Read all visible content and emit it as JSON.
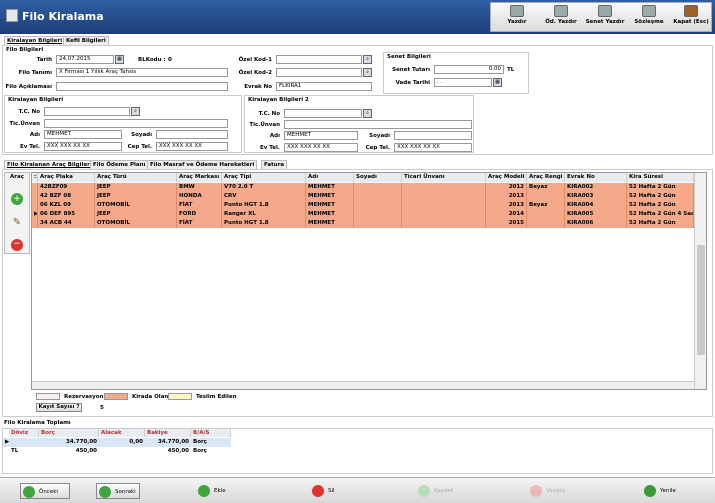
{
  "app": {
    "title": "Filo Kiralama"
  },
  "toolbar": [
    {
      "label": "Yazdır"
    },
    {
      "label": "Öd. Yazdır"
    },
    {
      "label": "Senet Yazdır"
    },
    {
      "label": "Sözleşme"
    },
    {
      "label": "Kapat (Esc)"
    }
  ],
  "tabs": {
    "top": [
      "Kiralayan Bilgileri",
      "Kefil Bilgileri"
    ],
    "grid": [
      "Filo Kiralanan Araç Bilgileri",
      "Filo Ödeme Planı",
      "Filo Masraf ve Ödeme Hareketleri",
      "Fatura"
    ]
  },
  "filo": {
    "section": "Filo Bilgileri",
    "tarih_label": "Tarih",
    "tarih": "24.07.2015",
    "blkodu_label": "BLKodu :",
    "blkodu": "0",
    "tanim_label": "Filo Tanımı",
    "tanim": "X Firması 1 Yıllık Araç Tahsis",
    "aciklama_label": "Filo Açıklaması",
    "aciklama": "",
    "ozel1_label": "Özel Kod-1",
    "ozel2_label": "Özel Kod-2",
    "evrak_label": "Evrak No",
    "evrak": "FLKIRA1"
  },
  "senet": {
    "section": "Senet Bilgileri",
    "tutar_label": "Senet Tutarı",
    "tutar": "0,00",
    "unit": "TL",
    "vade_label": "Vade Tarihi",
    "vade": ". ."
  },
  "kiralayan": {
    "section": "Kiralayan Bilgileri",
    "tc_label": "T.C. No",
    "unvan_label": "Tic.Ünvan",
    "adi_label": "Adı",
    "adi": "MEHMET",
    "soyadi_label": "Soyadı",
    "evtel_label": "Ev Tel.",
    "evtel": "XXX XXX XX XX",
    "ceptel_label": "Cep Tel.",
    "ceptel": "XXX XXX XX XX"
  },
  "kiralayan2": {
    "section": "Kiralayan Bilgileri 2",
    "tc_label": "T.C. No",
    "unvan_label": "Tic.Ünvan",
    "adi_label": "Adı",
    "adi": "MEHMET",
    "soyadi_label": "Soyadı",
    "evtel_label": "Ev Tel.",
    "evtel": "XXX XXX XX XX",
    "ceptel_label": "Cep Tel.",
    "ceptel": "XXX XXX XX XX"
  },
  "side": {
    "label": "Araç"
  },
  "grid": {
    "columns": [
      "Araç Plaka",
      "Araç Türü",
      "Araç Markası",
      "Araç Tipi",
      "Adı",
      "Soyadı",
      "Ticari Ünvanı",
      "Araç Modeli",
      "Araç Rengi",
      "Evrak No",
      "Kira Süresi"
    ],
    "rows": [
      [
        "42BZF09",
        "JEEP",
        "BMW",
        "V70 2.0 T",
        "MEHMET",
        "",
        "",
        "2012",
        "Beyaz",
        "KIRA002",
        "52 Hafta 2 Gün"
      ],
      [
        "42 BZF 08",
        "JEEP",
        "HONDA",
        "CRV",
        "MEHMET",
        "",
        "",
        "2013",
        "",
        "KIRA003",
        "52 Hafta 2 Gün"
      ],
      [
        "06 KZL 09",
        "OTOMOBİL",
        "FİAT",
        "Punto HGT 1.8",
        "MEHMET",
        "",
        "",
        "2013",
        "Beyaz",
        "KIRA004",
        "52 Hafta 2 Gün"
      ],
      [
        "06 DEF 895",
        "JEEP",
        "FORD",
        "Ranger XL",
        "MEHMET",
        "",
        "",
        "2014",
        "",
        "KIRA005",
        "52 Hafta 2 Gün 4 Saat"
      ],
      [
        "34 ACB 44",
        "OTOMOBİL",
        "FİAT",
        "Punto HGT 1.8",
        "MEHMET",
        "",
        "",
        "2015",
        "",
        "KIRA006",
        "52 Hafta 2 Gün"
      ]
    ]
  },
  "legend": {
    "items": [
      {
        "label": "Rezervasyon",
        "color": "#f8eef2"
      },
      {
        "label": "Kirada Olan",
        "color": "#f4a98a"
      },
      {
        "label": "Teslim Edilen",
        "color": "#fbf6c6"
      }
    ],
    "count_label": "Kayıt Sayısı ?",
    "count": "5"
  },
  "totals": {
    "section": "Filo Kiralama Toplamı",
    "columns": [
      "Döviz",
      "Borç",
      "Alacak",
      "Bakiye",
      "B/A/S"
    ],
    "rows": [
      [
        "",
        "34.770,00",
        "0,00",
        "34.770,00",
        "Borç"
      ],
      [
        "TL",
        "450,00",
        "",
        "450,00",
        "Borç"
      ]
    ]
  },
  "bottom": [
    {
      "label": "Önceki"
    },
    {
      "label": "Sonraki"
    },
    {
      "label": "Ekle"
    },
    {
      "label": "Sil"
    },
    {
      "label": "Kaydet"
    },
    {
      "label": "Vazgeç"
    },
    {
      "label": "Yenile"
    }
  ]
}
